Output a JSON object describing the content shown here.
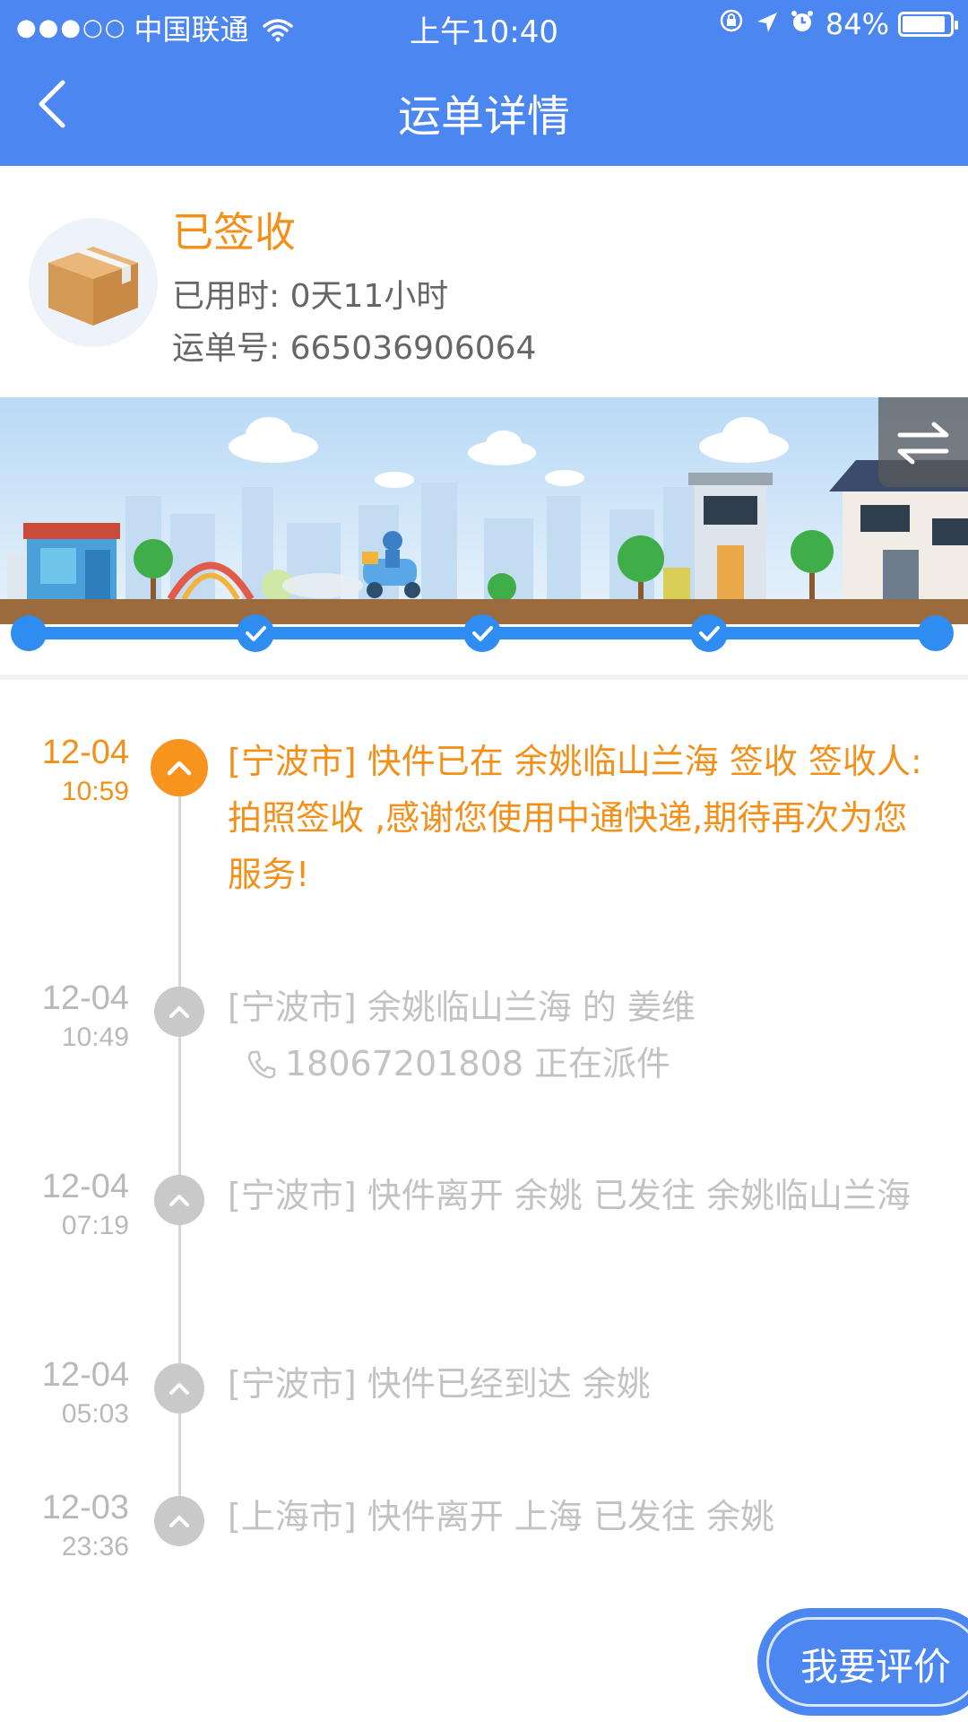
{
  "status_bar": {
    "signal_dots": "●●●○○",
    "carrier": "中国联通",
    "time": "上午10:40",
    "battery_text": "84%",
    "battery_level": 0.84
  },
  "nav": {
    "title": "运单详情",
    "back_icon": "chevron-left-icon"
  },
  "summary": {
    "status": "已签收",
    "elapsed_label": "已用时:",
    "elapsed_value": "0天11小时",
    "waybill_label": "运单号:",
    "waybill_value": "665036906064"
  },
  "progress": {
    "completed_steps": 5,
    "total_steps": 5,
    "swap_icon": "swap-icon"
  },
  "timeline": [
    {
      "date": "12-04",
      "time": "10:59",
      "text": "[宁波市] 快件已在 余姚临山兰海 签收 签收人: 拍照签收 ,感谢您使用中通快递,期待再次为您服务!",
      "active": true
    },
    {
      "date": "12-04",
      "time": "10:49",
      "text": "[宁波市] 余姚临山兰海 的 姜维",
      "phone": "18067201808 正在派件",
      "active": false
    },
    {
      "date": "12-04",
      "time": "07:19",
      "text": "[宁波市] 快件离开 余姚 已发往 余姚临山兰海",
      "active": false
    },
    {
      "date": "12-04",
      "time": "05:03",
      "text": "[宁波市] 快件已经到达 余姚",
      "active": false
    },
    {
      "date": "12-03",
      "time": "23:36",
      "text": "[上海市] 快件离开 上海 已发往 余姚",
      "active": false
    }
  ],
  "rate_button": {
    "label": "我要评价"
  },
  "colors": {
    "brand_blue": "#4c86f0",
    "accent_orange": "#f39019",
    "inactive_gray": "#c2c2c2"
  }
}
